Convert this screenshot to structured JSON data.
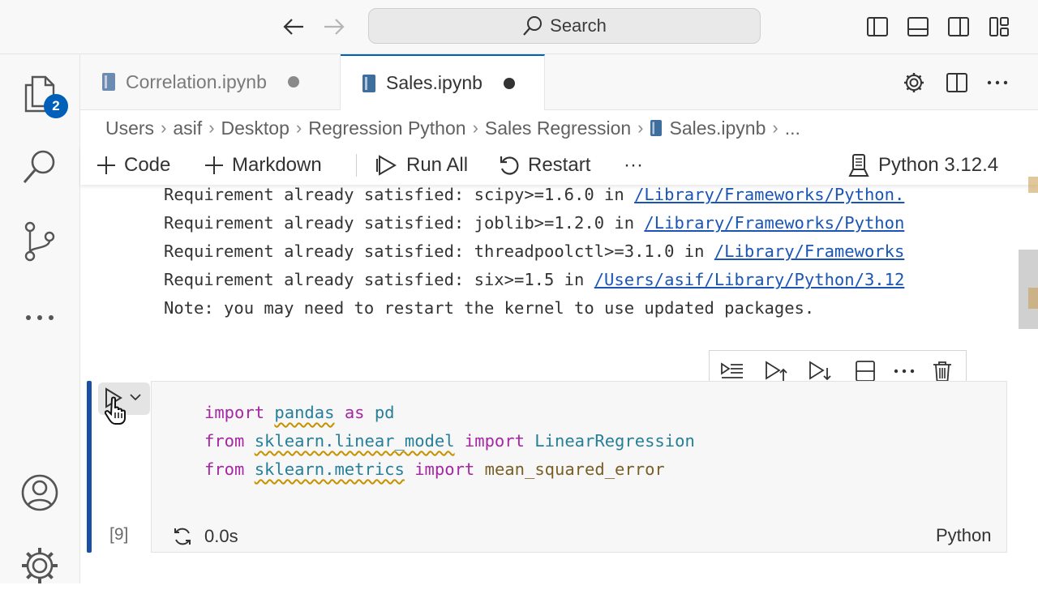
{
  "search": {
    "label": "Search"
  },
  "activity": {
    "explorer_badge": "2"
  },
  "tabs": [
    {
      "label": "Correlation.ipynb",
      "state": "modified",
      "active": false
    },
    {
      "label": "Sales.ipynb",
      "state": "modified",
      "active": true
    }
  ],
  "breadcrumb": [
    "Users",
    "asif",
    "Desktop",
    "Regression Python",
    "Sales Regression",
    "Sales.ipynb",
    "..."
  ],
  "toolbar": {
    "code_label": "Code",
    "markdown_label": "Markdown",
    "run_all_label": "Run All",
    "restart_label": "Restart",
    "more_label": "···",
    "kernel_label": "Python 3.12.4"
  },
  "output": {
    "lines": [
      {
        "text": "Requirement already satisfied: scipy>=1.6.0 in ",
        "link": "/Library/Frameworks/Python."
      },
      {
        "text": "Requirement already satisfied: joblib>=1.2.0 in ",
        "link": "/Library/Frameworks/Python"
      },
      {
        "text": "Requirement already satisfied: threadpoolctl>=3.1.0 in ",
        "link": "/Library/Frameworks"
      },
      {
        "text": "Requirement already satisfied: six>=1.5 in ",
        "link": "/Users/asif/Library/Python/3.12"
      },
      {
        "text": "Note: you may need to restart the kernel to use updated packages.",
        "link": ""
      }
    ]
  },
  "cell": {
    "code": [
      [
        {
          "t": "import",
          "c": "kw"
        },
        {
          "t": " ",
          "c": "plain"
        },
        {
          "t": "pandas",
          "c": "mod"
        },
        {
          "t": " ",
          "c": "plain"
        },
        {
          "t": "as",
          "c": "kw"
        },
        {
          "t": " pd",
          "c": "cls"
        }
      ],
      [
        {
          "t": "from",
          "c": "kw"
        },
        {
          "t": " ",
          "c": "plain"
        },
        {
          "t": "sklearn.linear_model",
          "c": "mod"
        },
        {
          "t": " ",
          "c": "plain"
        },
        {
          "t": "import",
          "c": "kw"
        },
        {
          "t": " LinearRegression",
          "c": "cls"
        }
      ],
      [
        {
          "t": "from",
          "c": "kw"
        },
        {
          "t": " ",
          "c": "plain"
        },
        {
          "t": "sklearn.metrics",
          "c": "mod"
        },
        {
          "t": " ",
          "c": "plain"
        },
        {
          "t": "import",
          "c": "kw"
        },
        {
          "t": " mean_squared_error",
          "c": "fn"
        }
      ]
    ],
    "execution_count": "[9]",
    "duration": "0.0s",
    "language": "Python"
  },
  "colors": {
    "accent": "#005fb8",
    "link": "#1a55b5",
    "keyword": "#a626a4",
    "module": "#267f99",
    "function": "#795e26",
    "cell_bar": "#1a4fa6"
  },
  "icons": {
    "titlebar": [
      "arrow-left-icon",
      "arrow-right-icon",
      "search-icon",
      "toggle-primary-sidebar-icon",
      "toggle-panel-icon",
      "toggle-secondary-sidebar-icon",
      "customize-layout-icon"
    ],
    "activity": [
      "explorer-icon",
      "search-icon",
      "source-control-icon",
      "more-icon",
      "accounts-icon",
      "manage-gear-icon"
    ],
    "cell_toolbar": [
      "run-by-line-icon",
      "execute-above-icon",
      "execute-below-icon",
      "split-cell-icon",
      "more-icon",
      "delete-cell-icon"
    ]
  }
}
